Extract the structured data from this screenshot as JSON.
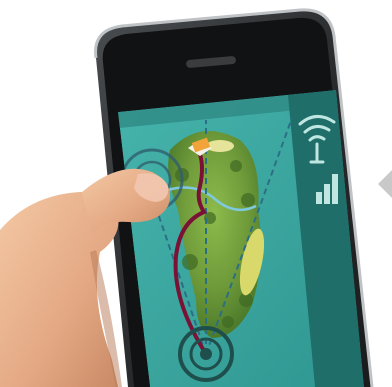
{
  "colors": {
    "background": "#ffffff",
    "phone_body": "#2a2c2e",
    "phone_bezel": "#111213",
    "screen_teal": "#3aa7a0",
    "side_panel": "#1f6e6a",
    "route_line": "#7a1236",
    "dashed_line": "#2b6f86",
    "fairway_green": "#6f9a3a",
    "sand_bunker": "#d9d86a",
    "pin_flag": "#f2a43a",
    "skin": "#e9b38c",
    "chevron": "#c9c9c9"
  },
  "icons": {
    "wifi": "wifi-signal-icon",
    "signal": "signal-bars-icon",
    "flag": "golf-flag-icon",
    "player": "player-position-marker-icon",
    "chevron": "chevron-left-icon"
  },
  "signal": {
    "bars_total": 3,
    "bars_active": 3
  }
}
